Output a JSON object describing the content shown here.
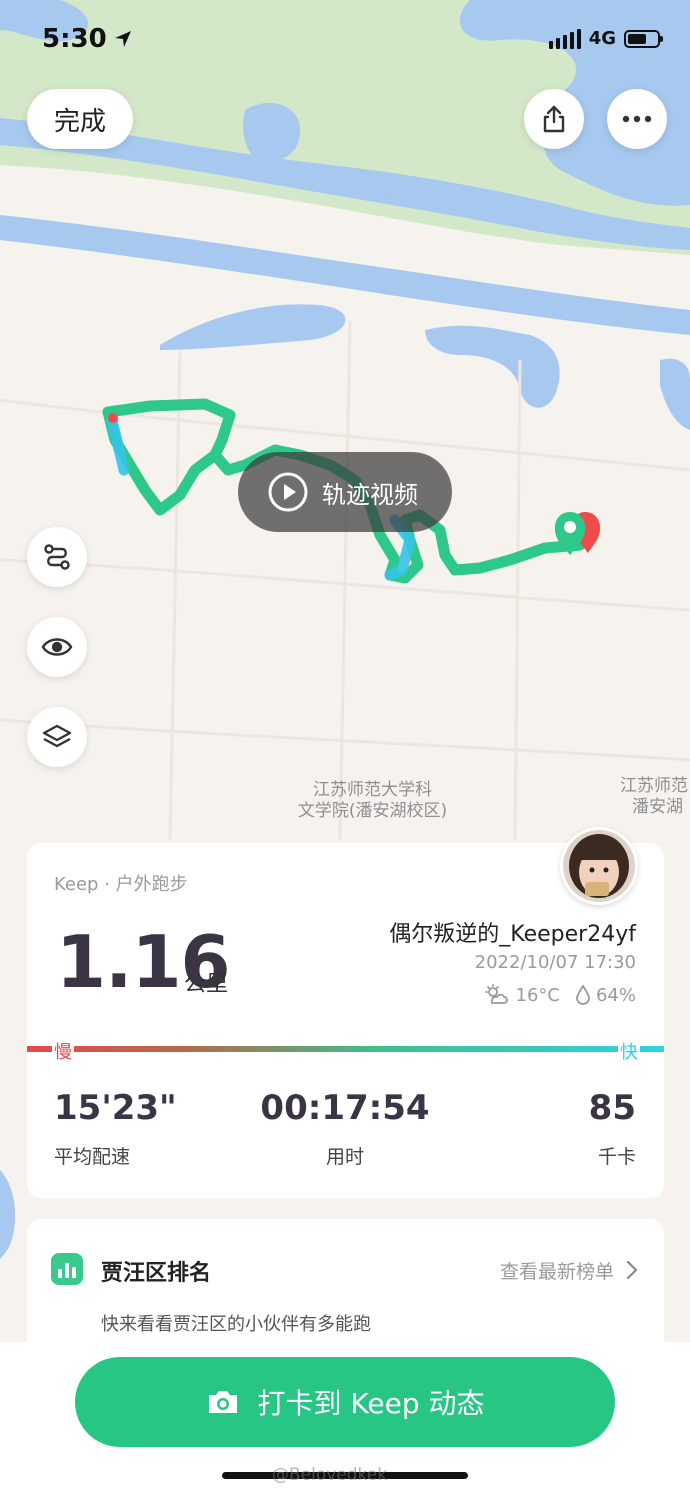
{
  "status_bar": {
    "time": "5:30",
    "network": "4G",
    "battery_level": 0.55
  },
  "top_bar": {
    "done_label": "完成"
  },
  "map": {
    "campus_label_1": [
      "江苏师范大学科",
      "文学院(潘安湖校区)"
    ],
    "campus_label_2": [
      "江苏师范",
      "潘安湖"
    ],
    "video_label": "轨迹视频",
    "colors": {
      "land": "#f6f3ef",
      "park": "#d3e8c8",
      "water": "#a7c8ef",
      "route": "#2ec98a",
      "route_fast": "#35c4e6",
      "route_slow": "#ee4b4b"
    }
  },
  "summary": {
    "source": "Keep · 户外跑步",
    "distance": "1.16",
    "distance_unit": "公里",
    "username": "偶尔叛逆的_Keeper24yf",
    "datetime": "2022/10/07 17:30",
    "temperature": "16°C",
    "humidity": "64%",
    "pace_slow": "慢",
    "pace_fast": "快",
    "stats": [
      {
        "value": "15'23\"",
        "label": "平均配速"
      },
      {
        "value": "00:17:54",
        "label": "用时"
      },
      {
        "value": "85",
        "label": "千卡"
      }
    ]
  },
  "ranking": {
    "title": "贾汪区排名",
    "link": "查看最新榜单",
    "description": "快来看看贾汪区的小伙伴有多能跑"
  },
  "cta": {
    "label": "打卡到 Keep 动态"
  },
  "watermark": "@Belovedkek"
}
